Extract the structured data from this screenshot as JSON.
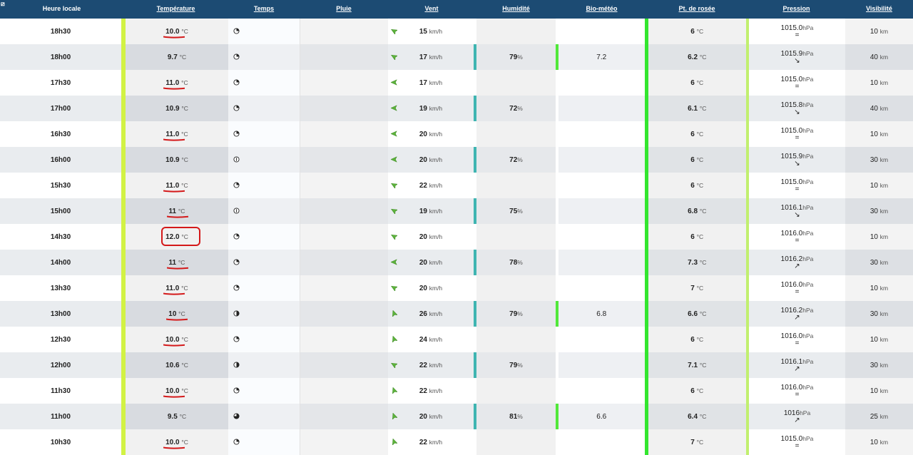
{
  "header": {
    "corner_glyph": "⧄",
    "columns": [
      "Heure locale",
      "Température",
      "Temps",
      "Pluie",
      "Vent",
      "Humidité",
      "Bio-météo",
      "Pt. de rosée",
      "Pression",
      "Visibilité"
    ]
  },
  "units": {
    "temp": "°C",
    "wind": "km/h",
    "humidity": "%",
    "pressure": "hPa",
    "visibility": "km"
  },
  "colors": {
    "header_bg": "#1c4b73",
    "temp_bar": "#d2f244",
    "humidity_bar": "#3fb5b1",
    "bio_bar": "#51e83a",
    "dew_bar": "#33e62f",
    "markup_red": "#d4191a"
  },
  "rows": [
    {
      "time": "18h30",
      "temp": "10.0",
      "weather": "partly-sun-icon",
      "wind": "15",
      "wind_dir": "south-west",
      "humidity": "",
      "bio": "",
      "dew": "6",
      "pressure": "1015.0",
      "trend": "=",
      "visibility": "10",
      "mark": "underline"
    },
    {
      "time": "18h00",
      "temp": "9.7",
      "weather": "partly-sun-icon",
      "wind": "17",
      "wind_dir": "south-west",
      "humidity": "79",
      "bio": "7.2",
      "dew": "6.2",
      "pressure": "1015.9",
      "trend": "↘",
      "visibility": "40",
      "mark": ""
    },
    {
      "time": "17h30",
      "temp": "11.0",
      "weather": "partly-sun-icon",
      "wind": "17",
      "wind_dir": "south",
      "humidity": "",
      "bio": "",
      "dew": "6",
      "pressure": "1015.0",
      "trend": "=",
      "visibility": "10",
      "mark": "underline"
    },
    {
      "time": "17h00",
      "temp": "10.9",
      "weather": "partly-sun-icon",
      "wind": "19",
      "wind_dir": "south",
      "humidity": "72",
      "bio": "",
      "dew": "6.1",
      "pressure": "1015.8",
      "trend": "↘",
      "visibility": "40",
      "mark": ""
    },
    {
      "time": "16h30",
      "temp": "11.0",
      "weather": "partly-sun-icon",
      "wind": "20",
      "wind_dir": "south",
      "humidity": "",
      "bio": "",
      "dew": "6",
      "pressure": "1015.0",
      "trend": "=",
      "visibility": "10",
      "mark": "underline"
    },
    {
      "time": "16h00",
      "temp": "10.9",
      "weather": "mist-icon",
      "wind": "20",
      "wind_dir": "south",
      "humidity": "72",
      "bio": "",
      "dew": "6",
      "pressure": "1015.9",
      "trend": "↘",
      "visibility": "30",
      "mark": ""
    },
    {
      "time": "15h30",
      "temp": "11.0",
      "weather": "partly-sun-icon",
      "wind": "22",
      "wind_dir": "south-west",
      "humidity": "",
      "bio": "",
      "dew": "6",
      "pressure": "1015.0",
      "trend": "=",
      "visibility": "10",
      "mark": "underline"
    },
    {
      "time": "15h00",
      "temp": "11",
      "weather": "mist-icon",
      "wind": "19",
      "wind_dir": "south-west",
      "humidity": "75",
      "bio": "",
      "dew": "6.8",
      "pressure": "1016.1",
      "trend": "↘",
      "visibility": "30",
      "mark": "underline"
    },
    {
      "time": "14h30",
      "temp": "12.0",
      "weather": "partly-sun-icon",
      "wind": "20",
      "wind_dir": "south-west",
      "humidity": "",
      "bio": "",
      "dew": "6",
      "pressure": "1016.0",
      "trend": "=",
      "visibility": "10",
      "mark": "circle"
    },
    {
      "time": "14h00",
      "temp": "11",
      "weather": "partly-sun-icon",
      "wind": "20",
      "wind_dir": "south",
      "humidity": "78",
      "bio": "",
      "dew": "7.3",
      "pressure": "1016.2",
      "trend": "↗",
      "visibility": "30",
      "mark": "underline"
    },
    {
      "time": "13h30",
      "temp": "11.0",
      "weather": "partly-sun-icon",
      "wind": "20",
      "wind_dir": "south-west",
      "humidity": "",
      "bio": "",
      "dew": "7",
      "pressure": "1016.0",
      "trend": "=",
      "visibility": "10",
      "mark": "underline"
    },
    {
      "time": "13h00",
      "temp": "10",
      "weather": "half-cloud-icon",
      "wind": "26",
      "wind_dir": "west",
      "humidity": "79",
      "bio": "6.8",
      "dew": "6.6",
      "pressure": "1016.2",
      "trend": "↗",
      "visibility": "30",
      "mark": "underline"
    },
    {
      "time": "12h30",
      "temp": "10.0",
      "weather": "partly-sun-icon",
      "wind": "24",
      "wind_dir": "west",
      "humidity": "",
      "bio": "",
      "dew": "6",
      "pressure": "1016.0",
      "trend": "=",
      "visibility": "10",
      "mark": "underline"
    },
    {
      "time": "12h00",
      "temp": "10.6",
      "weather": "half-cloud-icon",
      "wind": "22",
      "wind_dir": "south-west",
      "humidity": "79",
      "bio": "",
      "dew": "7.1",
      "pressure": "1016.1",
      "trend": "↗",
      "visibility": "30",
      "mark": ""
    },
    {
      "time": "11h30",
      "temp": "10.0",
      "weather": "partly-sun-icon",
      "wind": "22",
      "wind_dir": "west",
      "humidity": "",
      "bio": "",
      "dew": "6",
      "pressure": "1016.0",
      "trend": "=",
      "visibility": "10",
      "mark": "underline"
    },
    {
      "time": "11h00",
      "temp": "9.5",
      "weather": "mostly-cloudy-icon",
      "wind": "20",
      "wind_dir": "west",
      "humidity": "81",
      "bio": "6.6",
      "dew": "6.4",
      "pressure": "1016",
      "trend": "↗",
      "visibility": "25",
      "mark": ""
    },
    {
      "time": "10h30",
      "temp": "10.0",
      "weather": "partly-sun-icon",
      "wind": "22",
      "wind_dir": "west",
      "humidity": "",
      "bio": "",
      "dew": "7",
      "pressure": "1015.0",
      "trend": "=",
      "visibility": "10",
      "mark": "underline"
    }
  ]
}
